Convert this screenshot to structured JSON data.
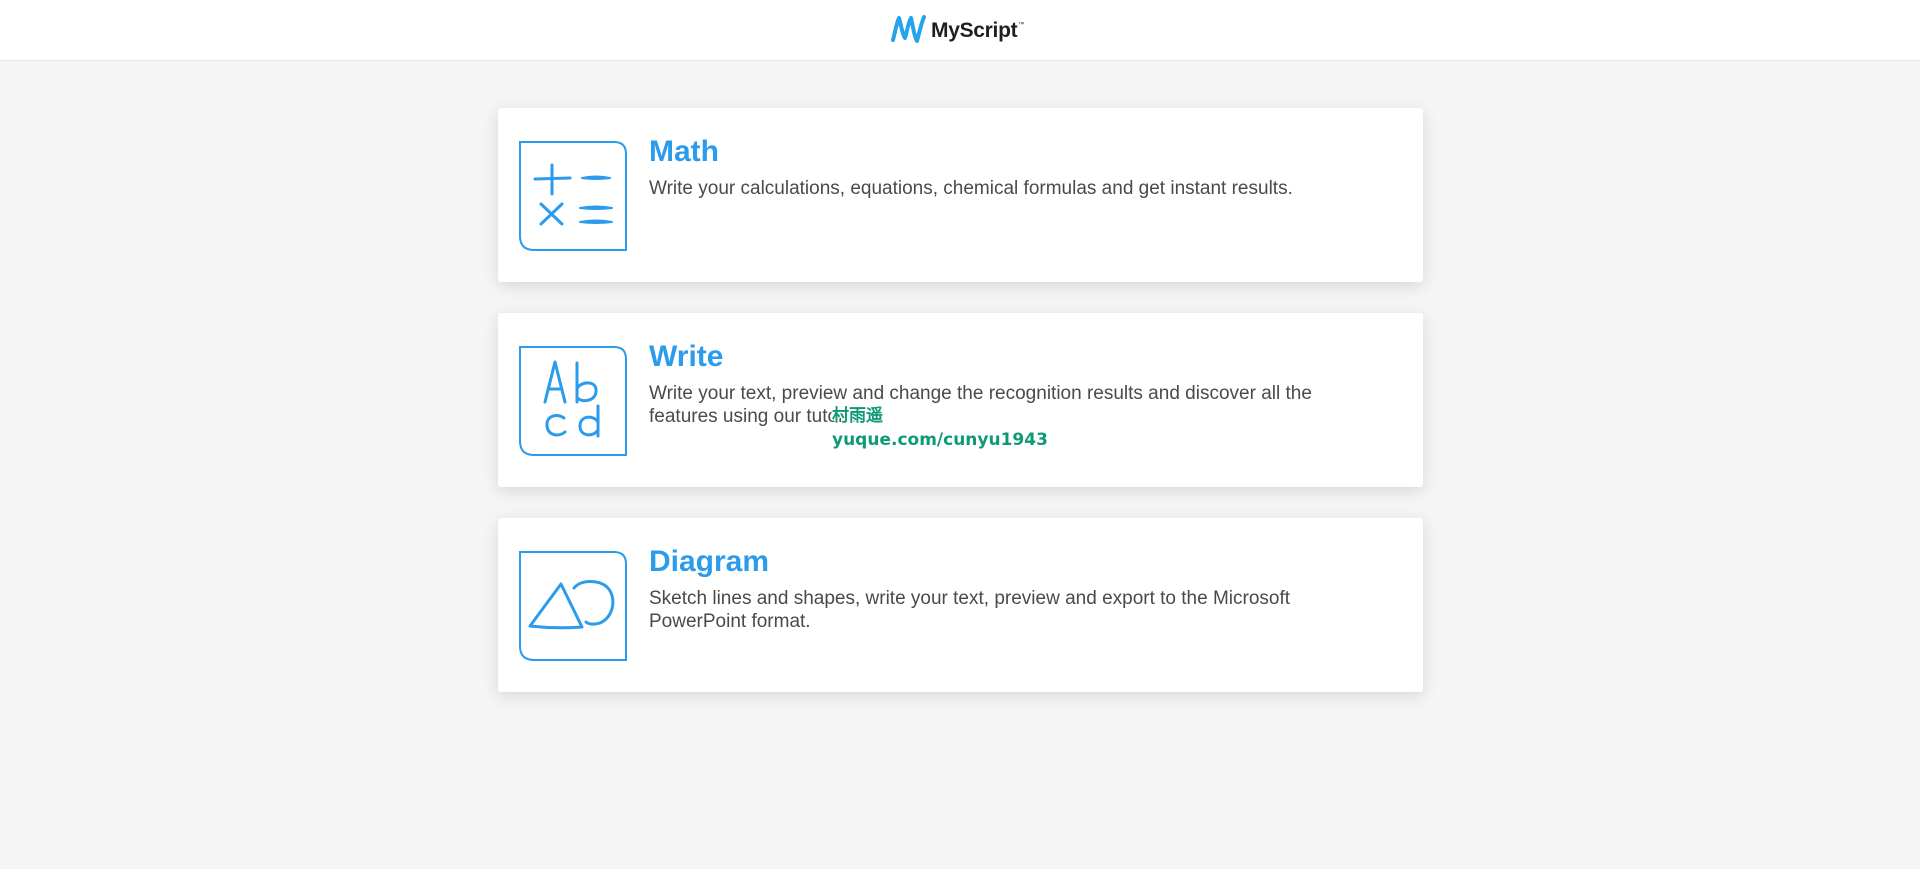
{
  "header": {
    "logo_text": "MyScript",
    "logo_tm": "™",
    "logo_icon": "myscript-m-icon"
  },
  "cards": [
    {
      "title": "Math",
      "description": "Write your calculations, equations, chemical formulas and get instant results.",
      "icon": "math-symbols-icon"
    },
    {
      "title": "Write",
      "description": "Write your text, preview and change the recognition results and discover all the features using our tutorial.",
      "icon": "abcd-letters-icon"
    },
    {
      "title": "Diagram",
      "description": "Sketch lines and shapes, write your text, preview and export to the Microsoft PowerPoint format.",
      "icon": "triangle-circle-icon"
    }
  ],
  "watermark": {
    "line1": "村雨遥",
    "line2": "yuque.com/cunyu1943"
  },
  "colors": {
    "accent": "#2b9bec",
    "background": "#f5f5f5",
    "card": "#ffffff",
    "text": "#4a4a4a"
  }
}
